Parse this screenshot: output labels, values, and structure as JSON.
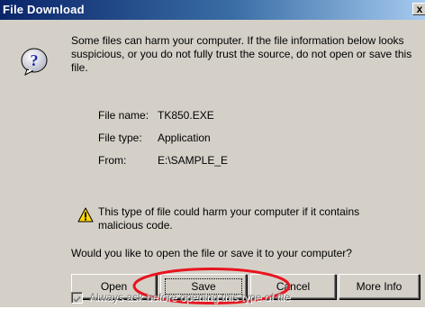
{
  "window": {
    "title": "File Download",
    "close_label": "x"
  },
  "message": {
    "warning": "Some files can harm your computer. If the file information below looks suspicious, or you do not fully trust the source, do not open or save this file."
  },
  "file_info": {
    "name_label": "File name:",
    "name_value": "TK850.EXE",
    "type_label": "File type:",
    "type_value": "Application",
    "from_label": "From:",
    "from_value": "E:\\SAMPLE_E"
  },
  "caution": {
    "text": "This type of file could harm your computer if it contains malicious code.",
    "icon": "warning-triangle-icon"
  },
  "prompt": {
    "text": "Would you like to open the file or save it to your computer?"
  },
  "buttons": {
    "open": "Open",
    "save": "Save",
    "cancel": "Cancel",
    "more_info": "More Info"
  },
  "checkbox": {
    "label": "Always ask before opening this type of file",
    "checked": true,
    "enabled": false
  },
  "annotation": {
    "highlight_color": "#e8141e",
    "highlight_target": "save-button"
  },
  "colors": {
    "titlebar_start": "#0a246a",
    "titlebar_end": "#a6caf0",
    "dialog_bg": "#d4d0c8"
  }
}
